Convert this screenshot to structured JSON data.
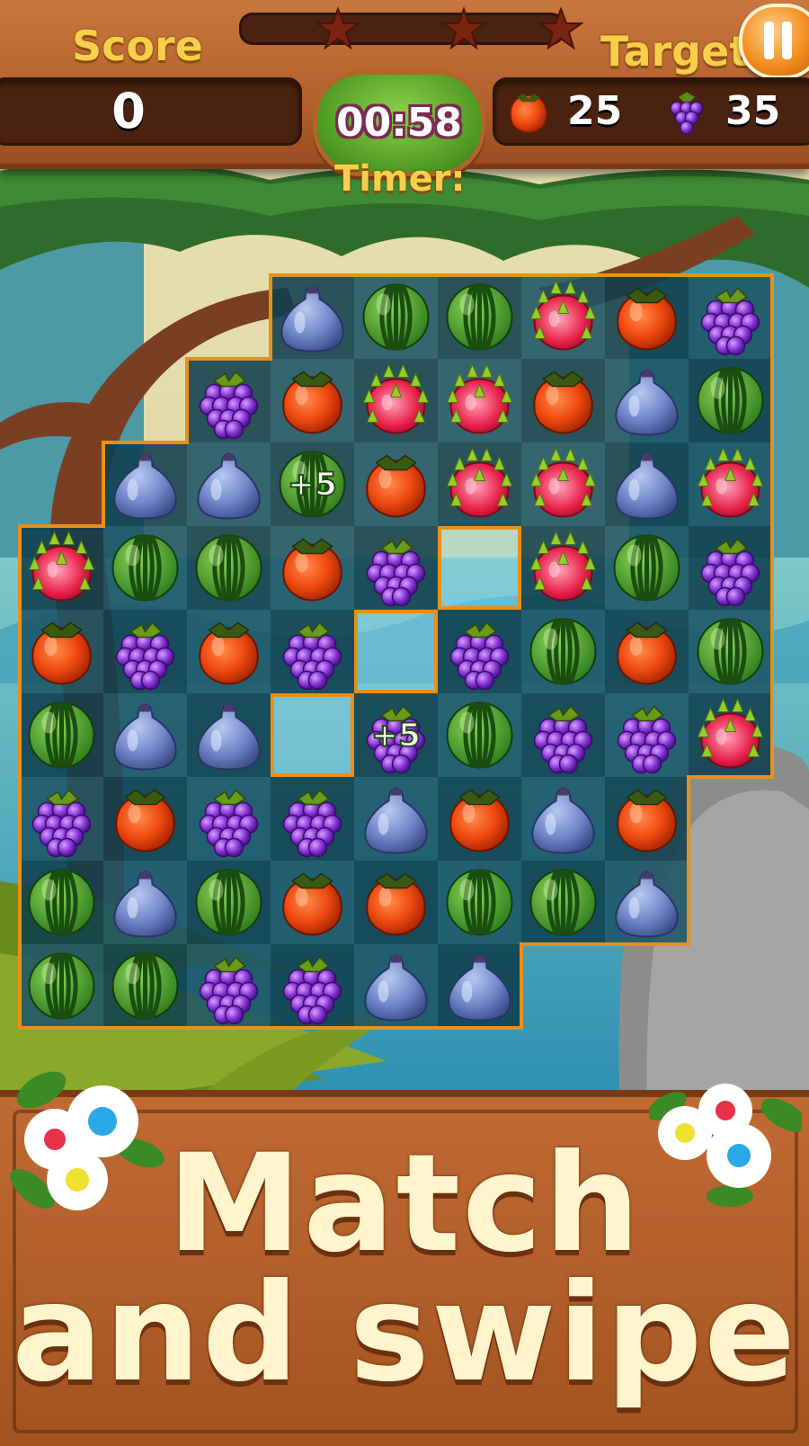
{
  "hud": {
    "score_label": "Score",
    "score_value": "0",
    "target_label": "Target",
    "timer_value": "00:58",
    "timer_label": "Timer:",
    "stars_earned": 0,
    "stars_total": 3,
    "targets": [
      {
        "fruit": "persimmon",
        "count": "25"
      },
      {
        "fruit": "grape",
        "count": "35"
      }
    ],
    "pause_icon": "pause-icon"
  },
  "board": {
    "rows": 9,
    "cols": 9,
    "grid": [
      [
        null,
        null,
        null,
        "fig",
        "watermelon",
        "watermelon",
        "dragonfruit",
        "persimmon",
        "grape"
      ],
      [
        null,
        null,
        "grape",
        "persimmon",
        "dragonfruit",
        "dragonfruit",
        "persimmon",
        "fig",
        "watermelon"
      ],
      [
        null,
        "fig",
        "fig",
        "watermelon",
        "persimmon",
        "dragonfruit",
        "dragonfruit",
        "fig",
        "dragonfruit"
      ],
      [
        "dragonfruit",
        "watermelon",
        "watermelon",
        "persimmon",
        "grape",
        "empty",
        "dragonfruit",
        "watermelon",
        "grape"
      ],
      [
        "persimmon",
        "grape",
        "persimmon",
        "grape",
        "empty",
        "grape",
        "watermelon",
        "persimmon",
        "watermelon"
      ],
      [
        "watermelon",
        "fig",
        "fig",
        "empty",
        "grape",
        "watermelon",
        "grape",
        "grape",
        "dragonfruit"
      ],
      [
        "grape",
        "persimmon",
        "grape",
        "grape",
        "fig",
        "persimmon",
        "fig",
        "persimmon",
        null
      ],
      [
        "watermelon",
        "fig",
        "watermelon",
        "persimmon",
        "persimmon",
        "watermelon",
        "watermelon",
        "fig",
        null
      ],
      [
        "watermelon",
        "watermelon",
        "grape",
        "grape",
        "fig",
        "fig",
        null,
        null,
        null
      ]
    ],
    "bonuses": [
      {
        "row": 2,
        "col": 3,
        "text": "+5"
      },
      {
        "row": 5,
        "col": 4,
        "text": "+5"
      }
    ]
  },
  "banner": {
    "line1": "Match",
    "line2": "and swipe"
  },
  "colors": {
    "wood": "#b4612d",
    "wood_dark": "#4a2210",
    "gold_text": "#f8cf48",
    "board_border": "#e8901a",
    "tile_dark": "#0f3f4d",
    "tile_light": "#1c5566",
    "timer_green": "#6ab832"
  }
}
